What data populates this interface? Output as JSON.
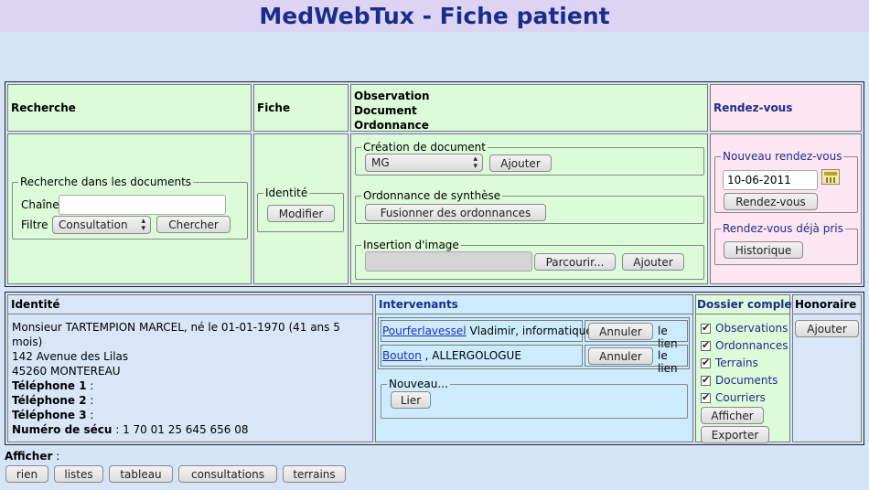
{
  "title": "MedWebTux - Fiche patient",
  "top": {
    "recherche": {
      "header": "Recherche",
      "legend": "Recherche dans les documents",
      "chaine_label": "Chaîne",
      "chaine_value": "",
      "filtre_label": "Filtre",
      "filtre_value": "Consultation",
      "search_button": "Chercher"
    },
    "fiche": {
      "header": "Fiche",
      "legend": "Identité",
      "modify_button": "Modifier"
    },
    "documents": {
      "header_lines": [
        "Observation",
        "Document",
        "Ordonnance"
      ],
      "creation_legend": "Création de document",
      "creation_select": "MG",
      "creation_add": "Ajouter",
      "synthese_legend": "Ordonnance de synthèse",
      "synthese_button": "Fusionner des ordonnances",
      "image_legend": "Insertion d'image",
      "browse_button": "Parcourir...",
      "image_add": "Ajouter"
    },
    "rdv": {
      "header": "Rendez-vous",
      "new_legend": "Nouveau rendez-vous",
      "date_value": "10-06-2011",
      "rdv_button": "Rendez-vous",
      "taken_legend": "Rendez-vous déjà pris",
      "history_button": "Historique"
    }
  },
  "bottom": {
    "identite": {
      "header": "Identité",
      "line1": "Monsieur TARTEMPION MARCEL, né le 01-01-1970 (41 ans 5 mois)",
      "line2": "142 Avenue des Lilas",
      "line3": "45260 MONTEREAU",
      "tel1_label": "Téléphone 1",
      "tel1_value": " :",
      "tel2_label": "Téléphone 2",
      "tel2_value": " :",
      "tel3_label": "Téléphone 3",
      "tel3_value": " :",
      "secu_label": "Numéro de sécu",
      "secu_value": " : 1 70 01 25 645 656 08"
    },
    "intervenants": {
      "header": "Intervenants",
      "rows": [
        {
          "link": "Pourferlavessel",
          "rest": " Vladimir, informatique",
          "cancel": "Annuler",
          "tail": "le lien"
        },
        {
          "link": "Bouton",
          "rest": " , ALLERGOLOGUE",
          "cancel": "Annuler",
          "tail": "le lien"
        }
      ],
      "new_legend": "Nouveau...",
      "link_button": "Lier"
    },
    "dossier": {
      "header": "Dossier complet",
      "items": [
        "Observations",
        "Ordonnances",
        "Terrains",
        "Documents",
        "Courriers"
      ],
      "show_button": "Afficher",
      "export_button": "Exporter"
    },
    "honoraire": {
      "header": "Honoraire",
      "add_button": "Ajouter"
    }
  },
  "footer": {
    "label": "Afficher",
    "suffix": " :",
    "buttons": [
      "rien",
      "listes",
      "tableau",
      "consultations",
      "terrains"
    ]
  }
}
